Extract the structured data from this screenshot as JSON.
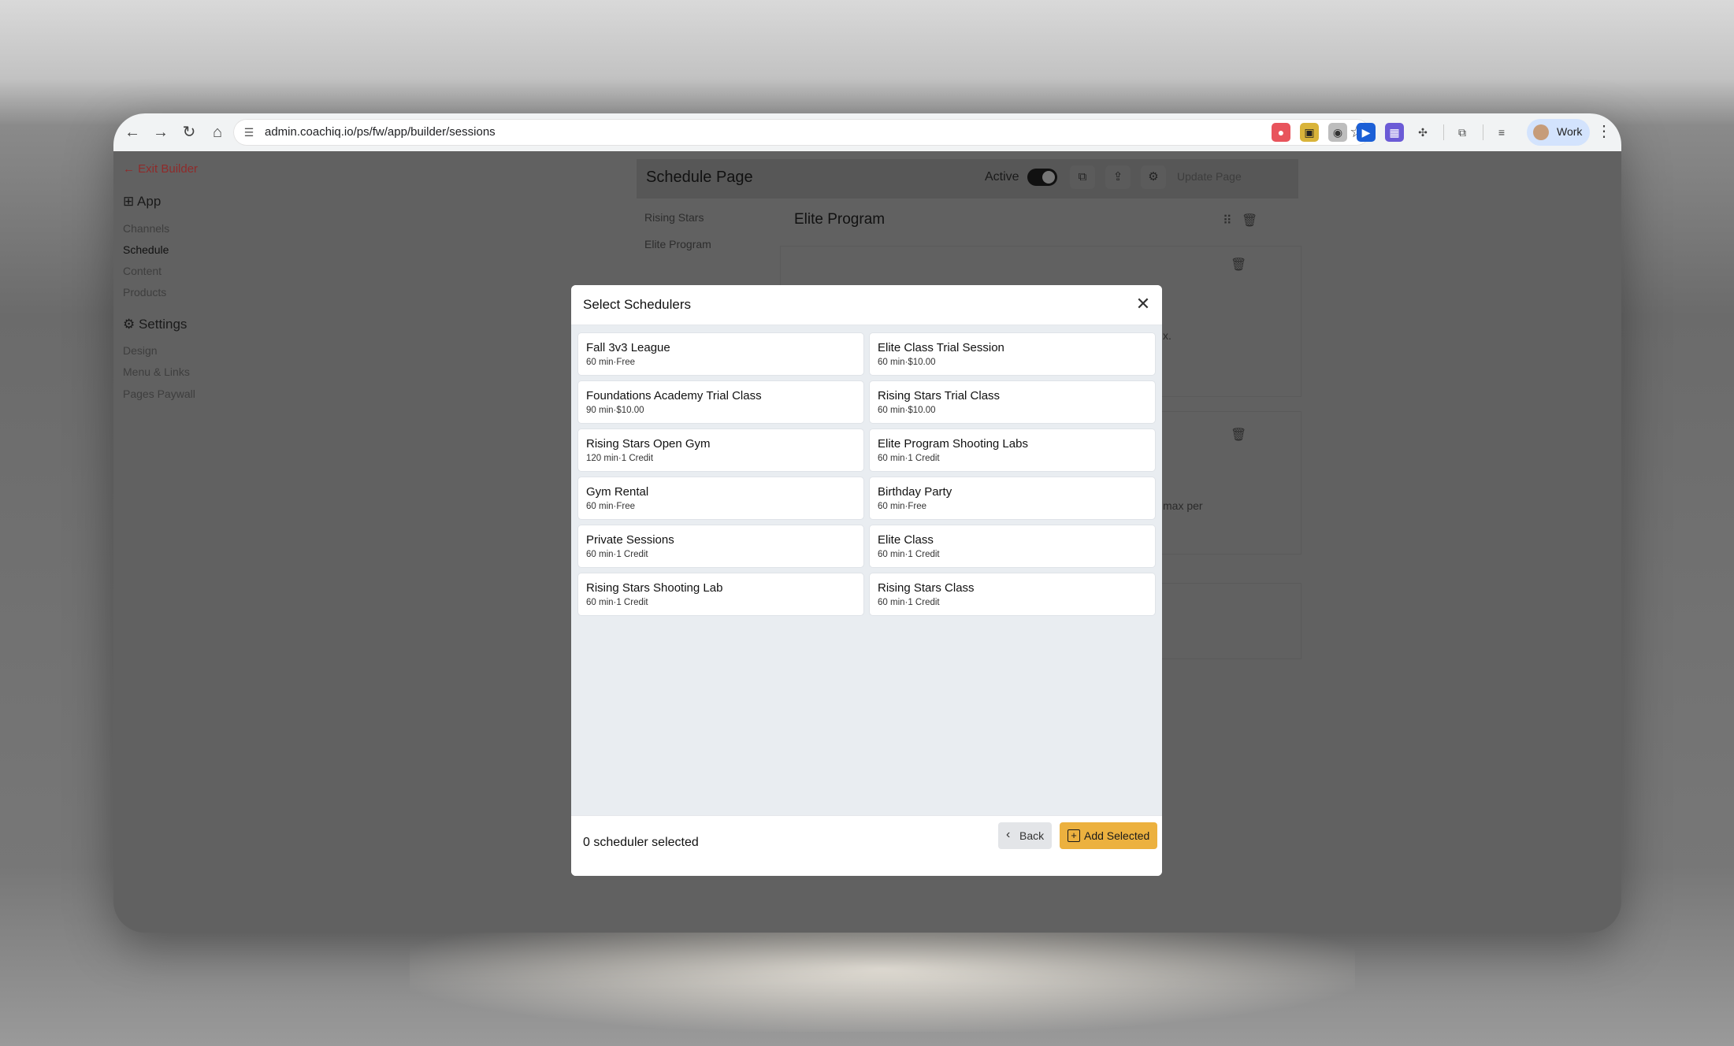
{
  "browser": {
    "url": "admin.coachiq.io/ps/fw/app/builder/sessions",
    "profile_label": "Work"
  },
  "sidebar": {
    "exit_label": "Exit Builder",
    "app_heading": "App",
    "app_items": [
      {
        "label": "Channels"
      },
      {
        "label": "Schedule"
      },
      {
        "label": "Content"
      },
      {
        "label": "Products"
      }
    ],
    "settings_heading": "Settings",
    "settings_items": [
      {
        "label": "Design"
      },
      {
        "label": "Menu & Links"
      },
      {
        "label": "Pages Paywall"
      }
    ]
  },
  "background_page": {
    "title": "Schedule Page",
    "active_label": "Active",
    "update_label": "Update Page",
    "tabs": [
      {
        "label": "Rising Stars"
      },
      {
        "label": "Elite Program"
      }
    ],
    "program_title": "Elite Program",
    "fragment_1": "x.",
    "fragment_2": "max per"
  },
  "modal": {
    "title": "Select Schedulers",
    "items": [
      {
        "title": "Fall 3v3 League",
        "meta": "60 min·Free"
      },
      {
        "title": "Elite Class Trial Session",
        "meta": "60 min·$10.00"
      },
      {
        "title": "Foundations Academy Trial Class",
        "meta": "90 min·$10.00"
      },
      {
        "title": "Rising Stars Trial Class",
        "meta": "60 min·$10.00"
      },
      {
        "title": "Rising Stars Open Gym",
        "meta": "120 min·1 Credit"
      },
      {
        "title": "Elite Program Shooting Labs",
        "meta": "60 min·1 Credit"
      },
      {
        "title": "Gym Rental",
        "meta": "60 min·Free"
      },
      {
        "title": "Birthday Party",
        "meta": "60 min·Free"
      },
      {
        "title": "Private Sessions",
        "meta": "60 min·1 Credit"
      },
      {
        "title": "Elite Class",
        "meta": "60 min·1 Credit"
      },
      {
        "title": "Rising Stars Shooting Lab",
        "meta": "60 min·1 Credit"
      },
      {
        "title": "Rising Stars Class",
        "meta": "60 min·1 Credit"
      }
    ],
    "selected_count": "0 scheduler selected",
    "back_label": "Back",
    "add_label": "Add Selected"
  },
  "colors": {
    "accent": "#ecb13f",
    "exit_red": "#8f2b2b"
  }
}
